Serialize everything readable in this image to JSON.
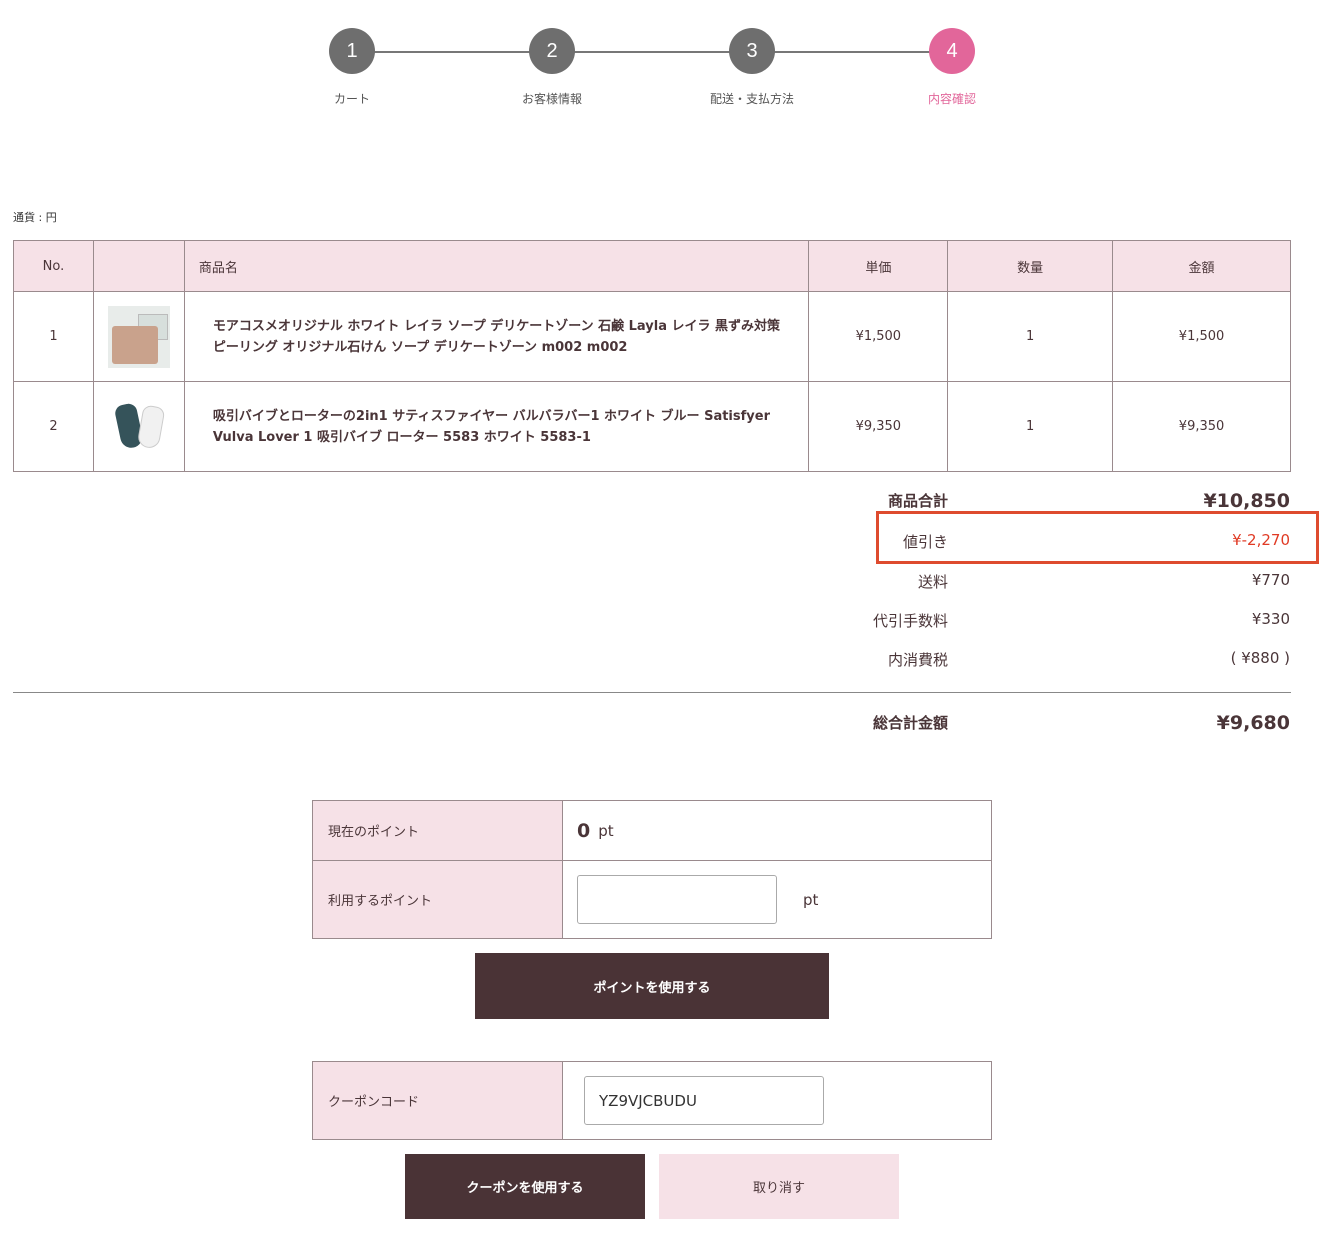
{
  "stepper": {
    "steps": [
      {
        "number": "1",
        "label": "カート"
      },
      {
        "number": "2",
        "label": "お客様情報"
      },
      {
        "number": "3",
        "label": "配送・支払方法"
      },
      {
        "number": "4",
        "label": "内容確認"
      }
    ],
    "active_step": "4",
    "active_color": "#e2669a"
  },
  "currency_note": "通貨 : 円",
  "cart": {
    "headers": {
      "no": "No.",
      "image": "",
      "name": "商品名",
      "unit_price": "単価",
      "quantity": "数量",
      "amount": "金額"
    },
    "rows": [
      {
        "no": "1",
        "image_icon": "soap-product-image",
        "name": "モアコスメオリジナル ホワイト レイラ ソープ デリケートゾーン 石鹸 Layla レイラ 黒ずみ対策 ピーリング オリジナル石けん ソープ デリケートゾーン m002 m002",
        "unit_price": "¥1,500",
        "quantity": "1",
        "amount": "¥1,500"
      },
      {
        "no": "2",
        "image_icon": "toy-product-image",
        "name": "吸引バイブとローターの2in1 サティスファイヤー バルバラバー1 ホワイト ブルー Satisfyer Vulva Lover 1 吸引バイブ ローター 5583 ホワイト 5583-1",
        "unit_price": "¥9,350",
        "quantity": "1",
        "amount": "¥9,350"
      }
    ]
  },
  "summary": {
    "subtotal_label": "商品合計",
    "subtotal_value": "¥10,850",
    "discount_label": "値引き",
    "discount_value": "¥-2,270",
    "shipping_label": "送料",
    "shipping_value": "¥770",
    "cod_fee_label": "代引手数料",
    "cod_fee_value": "¥330",
    "tax_label": "内消費税",
    "tax_value": "( ¥880 )",
    "total_label": "総合計金額",
    "total_value": "¥9,680",
    "discount_color": "#e03a24",
    "highlight_color": "#de4b2f"
  },
  "points": {
    "current_label": "現在のポイント",
    "current_value": "0",
    "current_unit": "pt",
    "use_label": "利用するポイント",
    "use_value": "",
    "use_unit": "pt",
    "apply_button": "ポイントを使用する"
  },
  "coupon": {
    "label": "クーポンコード",
    "value": "YZ9VJCBUDU",
    "apply_button": "クーポンを使用する",
    "cancel_button": "取り消す"
  }
}
